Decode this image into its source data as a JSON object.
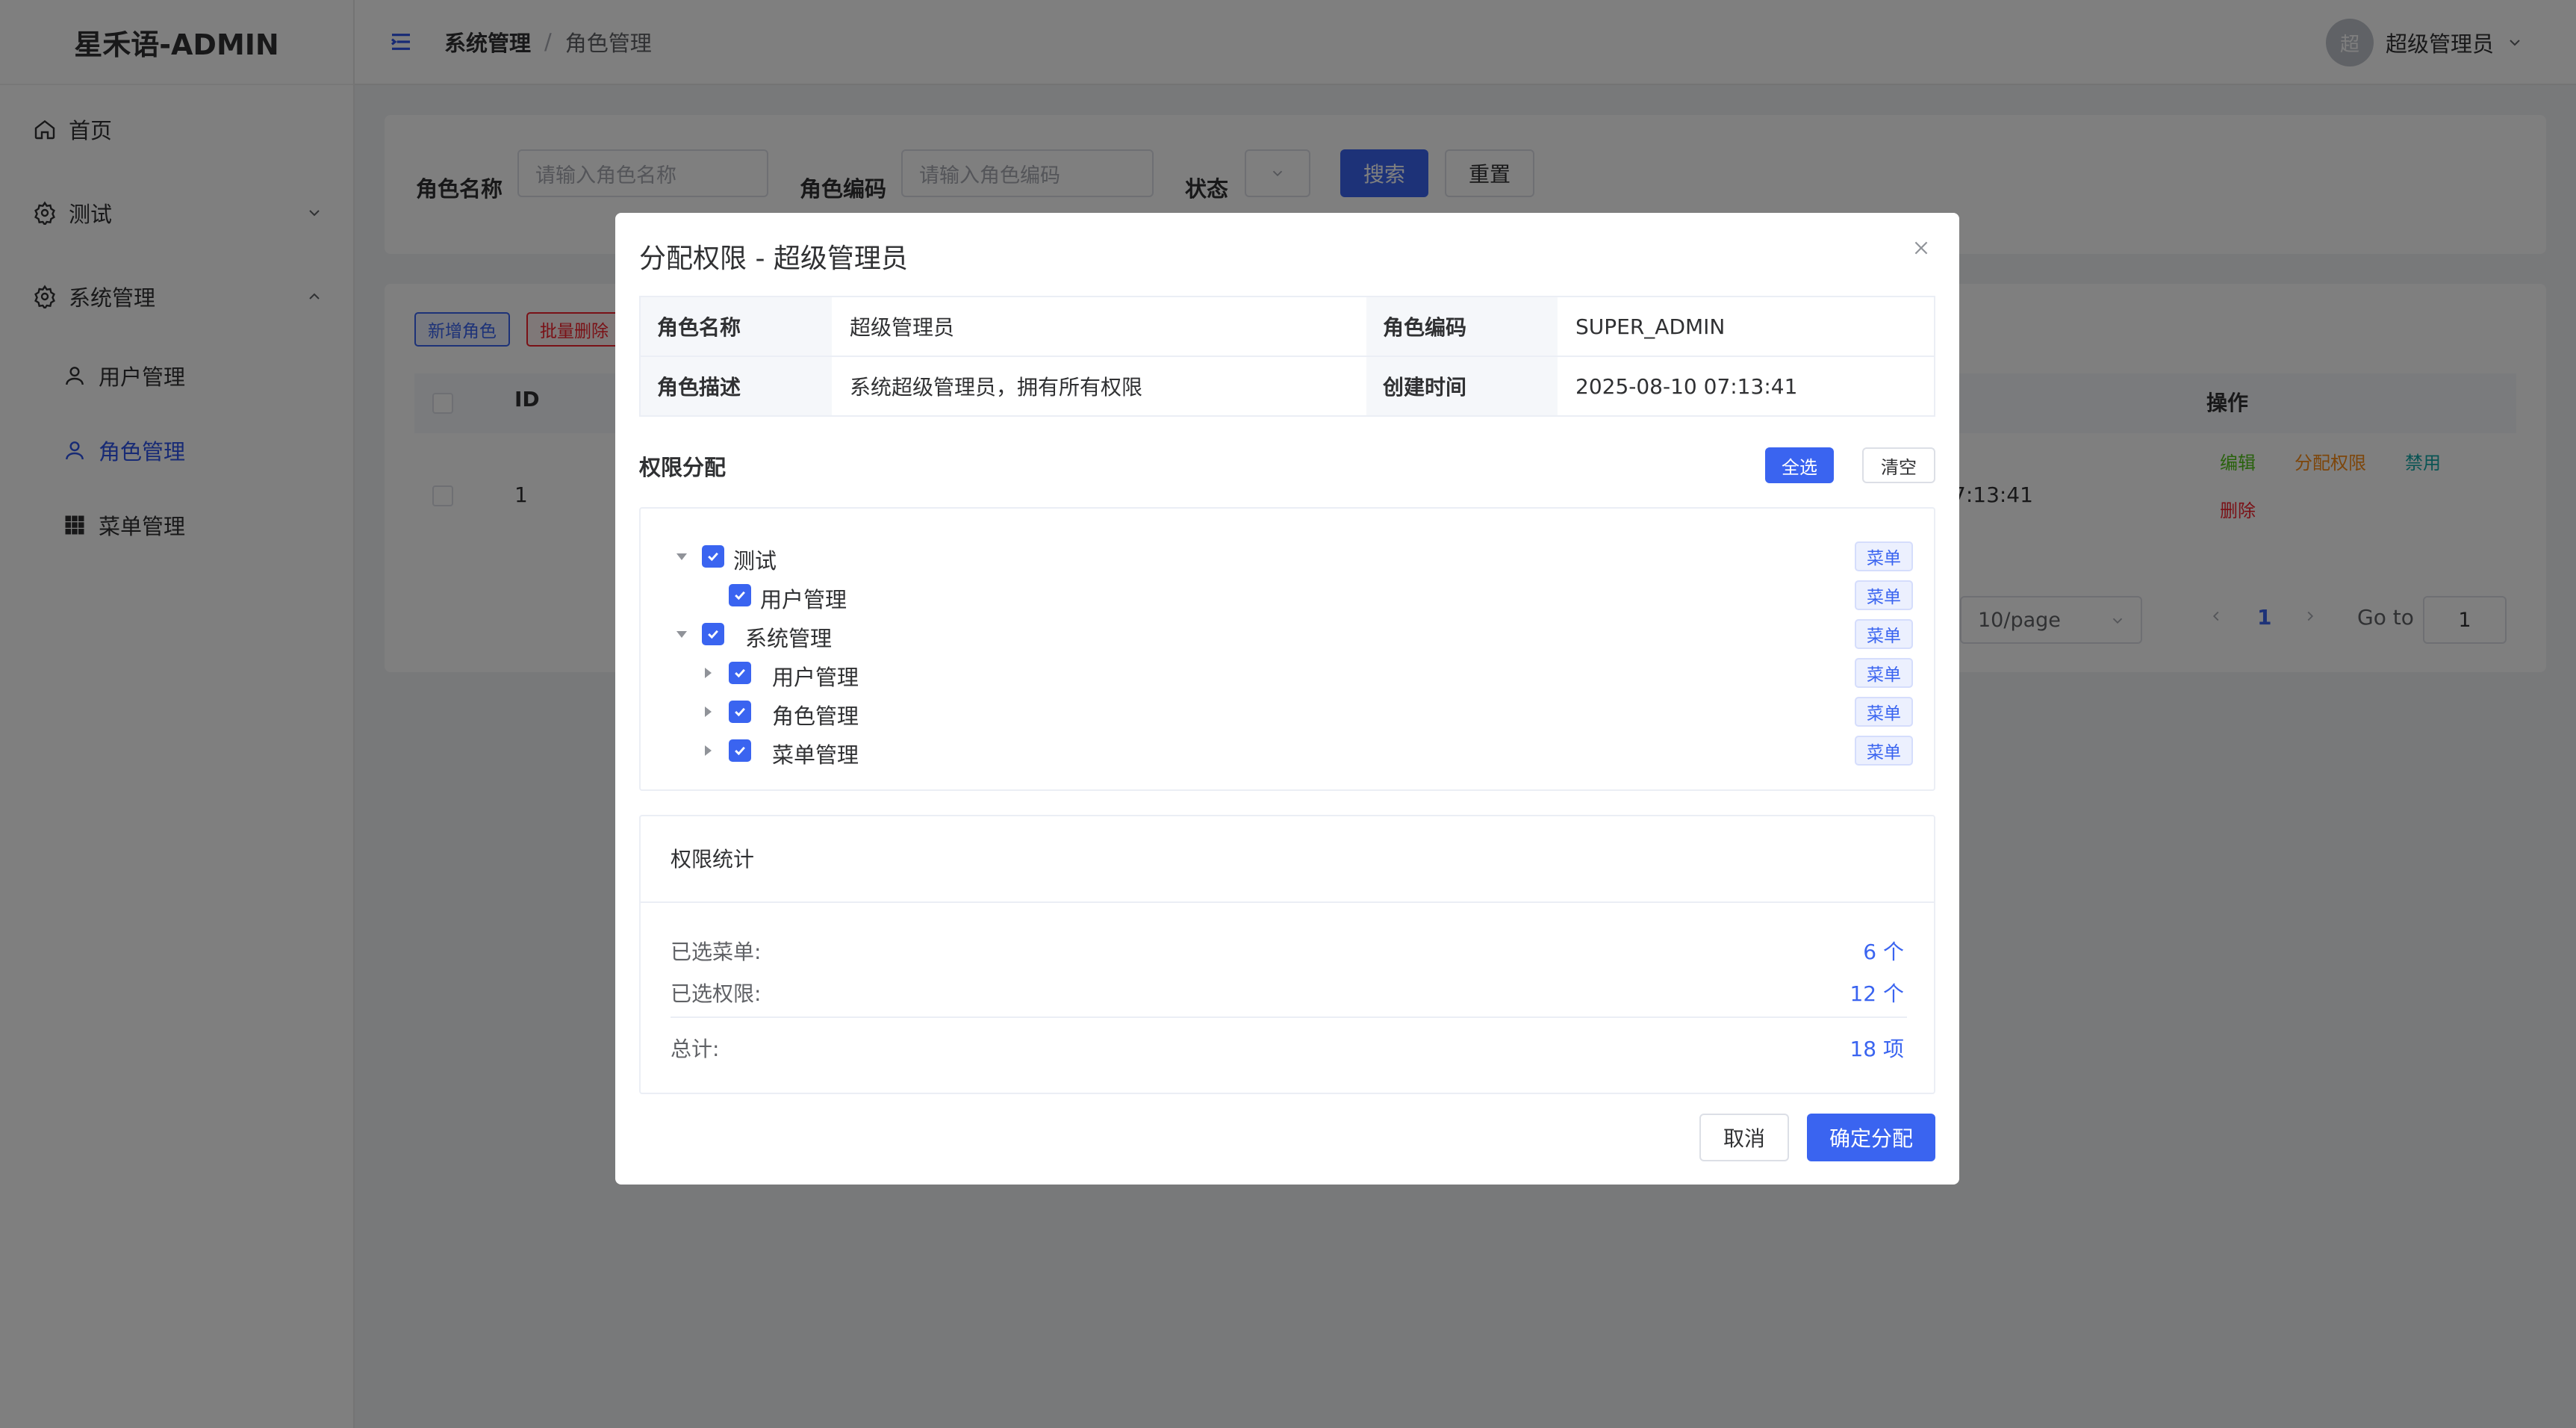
{
  "app": {
    "logo": "星禾语-ADMIN"
  },
  "sidebar": {
    "items": [
      {
        "label": "首页"
      },
      {
        "label": "测试"
      },
      {
        "label": "系统管理"
      },
      {
        "label": "用户管理"
      },
      {
        "label": "角色管理"
      },
      {
        "label": "菜单管理"
      }
    ]
  },
  "header": {
    "breadcrumb": [
      "系统管理",
      "/",
      "角色管理"
    ],
    "avatar_text": "超",
    "user_name": "超级管理员"
  },
  "search": {
    "role_name_label": "角色名称",
    "role_name_placeholder": "请输入角色名称",
    "role_code_label": "角色编码",
    "role_code_placeholder": "请输入角色编码",
    "status_label": "状态",
    "search_button": "搜索",
    "reset_button": "重置"
  },
  "table": {
    "add_button": "新增角色",
    "batch_delete_button": "批量删除",
    "columns": {
      "id": "ID",
      "actions": "操作"
    },
    "row": {
      "id": "1",
      "time_fragment": "7:13:41",
      "actions": {
        "edit": "编辑",
        "assign": "分配权限",
        "disable": "禁用",
        "delete": "删除"
      }
    },
    "pagination": {
      "page_size": "10/page",
      "current": "1",
      "goto_label": "Go to",
      "goto_value": "1"
    }
  },
  "dialog": {
    "title": "分配权限 - 超级管理员",
    "info": {
      "role_name_key": "角色名称",
      "role_name_value": "超级管理员",
      "role_code_key": "角色编码",
      "role_code_value": "SUPER_ADMIN",
      "desc_key": "角色描述",
      "desc_value": "系统超级管理员，拥有所有权限",
      "created_key": "创建时间",
      "created_value": "2025-08-10 07:13:41"
    },
    "permission_section": "权限分配",
    "select_all": "全选",
    "clear": "清空",
    "tree": [
      {
        "label": "测试",
        "tag": "菜单",
        "checked": true,
        "expanded": true
      },
      {
        "label": "用户管理",
        "tag": "菜单",
        "checked": true
      },
      {
        "label": "系统管理",
        "tag": "菜单",
        "checked": true,
        "expanded": true
      },
      {
        "label": "用户管理",
        "tag": "菜单",
        "checked": true,
        "expanded": false
      },
      {
        "label": "角色管理",
        "tag": "菜单",
        "checked": true,
        "expanded": false
      },
      {
        "label": "菜单管理",
        "tag": "菜单",
        "checked": true,
        "expanded": false
      }
    ],
    "stats": {
      "title": "权限统计",
      "selected_menus_label": "已选菜单:",
      "selected_menus_value": "6 个",
      "selected_perms_label": "已选权限:",
      "selected_perms_value": "12 个",
      "total_label": "总计:",
      "total_value": "18 项"
    },
    "cancel_button": "取消",
    "confirm_button": "确定分配"
  },
  "colors": {
    "primary": "#3a64f0",
    "edit": "#52c41a",
    "assign": "#fa8c16",
    "disable": "#13a8a8",
    "delete": "#f5222d"
  }
}
